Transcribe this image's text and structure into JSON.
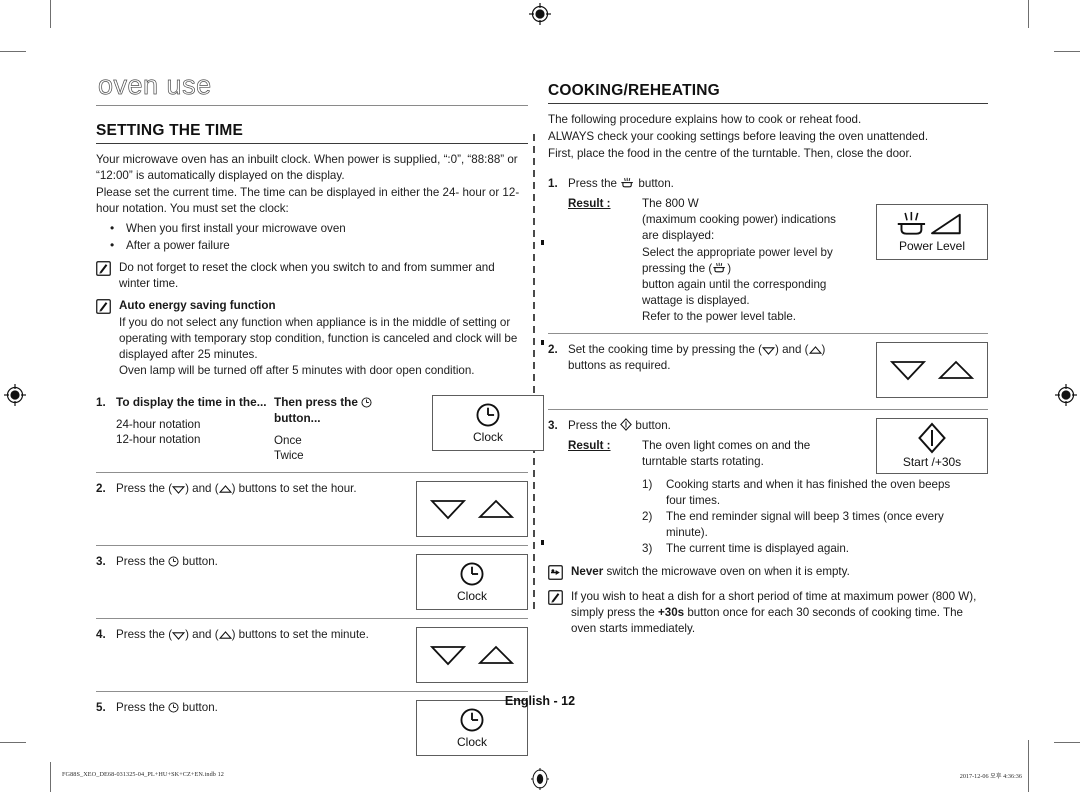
{
  "document": {
    "chapter_title": "oven use",
    "page_label": "English - 12",
    "footer_left": "FG88S_XEO_DE68-031325-04_PL+HU+SK+CZ+EN.indb   12",
    "footer_right": "2017-12-06   오후 4:36:36"
  },
  "left_column": {
    "section_title": "SETTING THE TIME",
    "paragraphs": [
      "Your microwave oven has an inbuilt clock. When power is supplied, “:0”, “88:88” or “12:00” is automatically displayed on the display.",
      "Please set the current time. The time can be displayed in either the 24- hour or 12-hour notation. You must set the clock:"
    ],
    "bullets": [
      "When you first install your microwave oven",
      "After a power failure"
    ],
    "notes": [
      {
        "icon": "note-pencil-icon",
        "title": "",
        "body": "Do not forget to reset the clock when you switch to and from summer and winter time."
      },
      {
        "icon": "note-pencil-icon",
        "title": "Auto energy saving function",
        "body": "If you do not select any function when appliance is in the middle of setting or operating with temporary stop condition, function is canceled and clock will be displayed after 25 minutes.",
        "body2": "Oven lamp will be turned off after 5 minutes with door open condition."
      }
    ],
    "steps": [
      {
        "num": "1.",
        "type": "table",
        "header_a": "To display the time in the...",
        "header_b": "Then press the ⓬ button...",
        "rows": [
          {
            "a": "24-hour notation",
            "b": "Once"
          },
          {
            "a": "12-hour notation",
            "b": "Twice"
          }
        ],
        "button": {
          "icon": "clock-icon",
          "label": "Clock"
        }
      },
      {
        "num": "2.",
        "type": "text",
        "text_pre": "Press the (",
        "text_mid": ") and (",
        "text_post": ") buttons to set the hour.",
        "button": {
          "icon": "arrows-down-up-icon",
          "label": ""
        }
      },
      {
        "num": "3.",
        "type": "text",
        "text_pre": "Press the ",
        "text_post": " button.",
        "button": {
          "icon": "clock-icon",
          "label": "Clock"
        }
      },
      {
        "num": "4.",
        "type": "text",
        "text_pre": "Press the (",
        "text_mid": ") and (",
        "text_post": ") buttons to set the minute.",
        "button": {
          "icon": "arrows-down-up-icon",
          "label": ""
        }
      },
      {
        "num": "5.",
        "type": "text",
        "text_pre": "Press the ",
        "text_post": " button.",
        "button": {
          "icon": "clock-icon",
          "label": "Clock"
        }
      }
    ]
  },
  "right_column": {
    "section_title": "COOKING/REHEATING",
    "paragraphs": [
      "The following procedure explains how to cook or reheat food.",
      "ALWAYS check your cooking settings before leaving the oven unattended.",
      "First, place the food in the centre of the turntable. Then, close the door."
    ],
    "steps": [
      {
        "num": "1.",
        "text_pre": "Press the ",
        "text_post": " button.",
        "result_label": "Result :",
        "result_lines": [
          "The 800 W",
          "(maximum cooking power) indications",
          "are displayed:"
        ],
        "result_extra_pre": "Select the appropriate power level by pressing the (",
        "result_extra_post": ")",
        "result_extra_2": "button again until the corresponding wattage is displayed.",
        "result_extra_3": "Refer to the power level table.",
        "button": {
          "icon": "power-level-icon",
          "label": "Power Level"
        }
      },
      {
        "num": "2.",
        "text_pre": "Set the cooking time by pressing the (",
        "text_mid": ") and (",
        "text_post": ")",
        "text_line2": "buttons as required.",
        "button": {
          "icon": "arrows-down-up-icon",
          "label": ""
        }
      },
      {
        "num": "3.",
        "text_pre": "Press the ",
        "text_post": " button.",
        "result_label": "Result :",
        "result_lines": [
          "The oven light comes on and the",
          "turntable starts rotating."
        ],
        "sub_items": [
          {
            "mark": "1)",
            "text": "Cooking starts and when it has finished the oven beeps four times."
          },
          {
            "mark": "2)",
            "text": "The end reminder signal will beep 3 times (once every minute)."
          },
          {
            "mark": "3)",
            "text": "The current time is displayed again."
          }
        ],
        "button": {
          "icon": "start-icon",
          "label": "Start /+30s"
        }
      }
    ],
    "notes": [
      {
        "icon": "pointing-hand-icon",
        "strong": "Never",
        "body": " switch the microwave oven on when it is empty."
      },
      {
        "icon": "note-pencil-icon",
        "body_pre": "If you wish to heat a dish for a short period of time at maximum power (800 W), simply press the ",
        "body_strong": "+30s",
        "body_post": " button once for each 30 seconds of cooking time. The oven starts immediately."
      }
    ]
  },
  "colors": {
    "text": "#1d1d1d",
    "rule": "#8f8f8f",
    "chapter": "#4d4d4d",
    "crop_mark": "#6f6f6f"
  }
}
